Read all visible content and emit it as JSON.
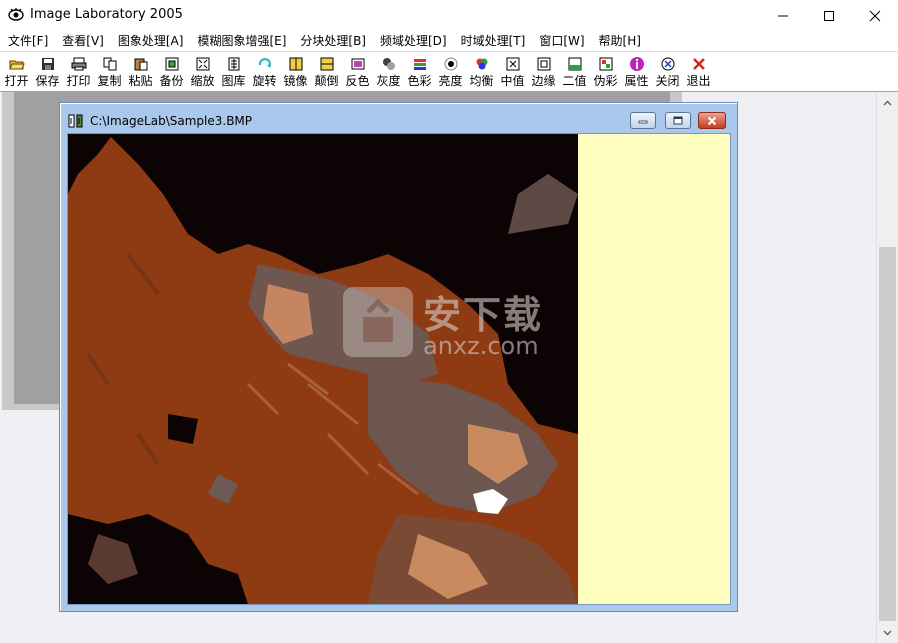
{
  "app": {
    "title": "Image Laboratory 2005",
    "icon": "eye-icon"
  },
  "window_controls": [
    "minimize-icon",
    "maximize-icon",
    "close-icon"
  ],
  "menu": [
    {
      "label": "文件[F]"
    },
    {
      "label": "查看[V]"
    },
    {
      "label": "图象处理[A]"
    },
    {
      "label": "模糊图象增强[E]"
    },
    {
      "label": "分块处理[B]"
    },
    {
      "label": "频域处理[D]"
    },
    {
      "label": "时域处理[T]"
    },
    {
      "label": "窗口[W]"
    },
    {
      "label": "帮助[H]"
    }
  ],
  "toolbar": [
    {
      "label": "打开",
      "icon": "open-folder-icon"
    },
    {
      "label": "保存",
      "icon": "save-disk-icon"
    },
    {
      "label": "打印",
      "icon": "printer-icon"
    },
    {
      "label": "复制",
      "icon": "copy-icon"
    },
    {
      "label": "粘贴",
      "icon": "paste-icon"
    },
    {
      "label": "备份",
      "icon": "backup-icon"
    },
    {
      "label": "缩放",
      "icon": "zoom-icon"
    },
    {
      "label": "图库",
      "icon": "gallery-icon"
    },
    {
      "label": "旋转",
      "icon": "rotate-icon"
    },
    {
      "label": "镜像",
      "icon": "mirror-icon"
    },
    {
      "label": "颠倒",
      "icon": "flip-icon"
    },
    {
      "label": "反色",
      "icon": "invert-icon"
    },
    {
      "label": "灰度",
      "icon": "grayscale-icon"
    },
    {
      "label": "色彩",
      "icon": "color-icon"
    },
    {
      "label": "亮度",
      "icon": "brightness-icon"
    },
    {
      "label": "均衡",
      "icon": "equalize-icon"
    },
    {
      "label": "中值",
      "icon": "median-icon"
    },
    {
      "label": "边缘",
      "icon": "edge-icon"
    },
    {
      "label": "二值",
      "icon": "binary-icon"
    },
    {
      "label": "伪彩",
      "icon": "pseudocolor-icon"
    },
    {
      "label": "属性",
      "icon": "properties-icon"
    },
    {
      "label": "关闭",
      "icon": "close-doc-icon"
    },
    {
      "label": "退出",
      "icon": "exit-icon"
    }
  ],
  "child_window": {
    "title": "C:\\ImageLab\\Sample3.BMP"
  },
  "watermark": {
    "text_cn": "安下载",
    "text_en": "anxz.com"
  },
  "colors": {
    "child_frame": "#a9c8eb",
    "image_bg": "#fefebf",
    "photo_main": "#8e3a12",
    "photo_dark": "#0c0404",
    "mdi_bg": "#f0eff3"
  }
}
